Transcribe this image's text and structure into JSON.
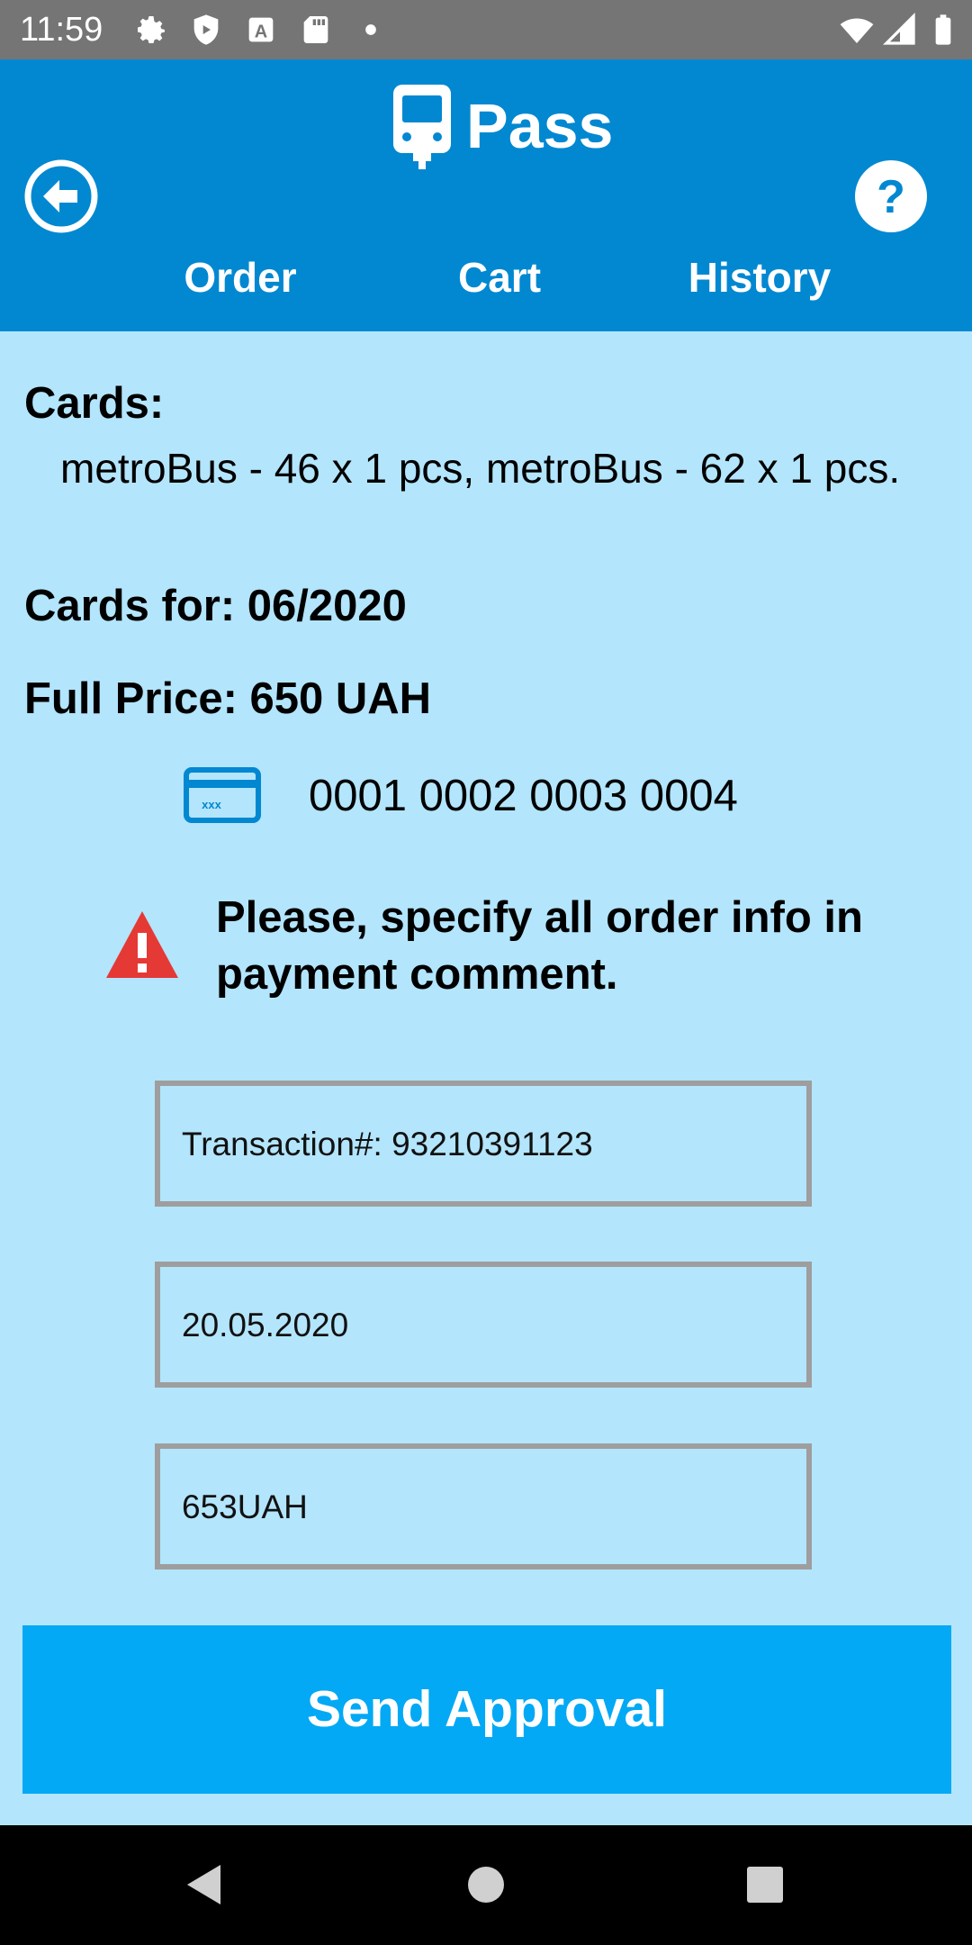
{
  "status_bar": {
    "time": "11:59",
    "left_icons": [
      "gear-icon",
      "shield-icon",
      "font-icon",
      "sd-card-icon",
      "dot-icon"
    ],
    "right_icons": [
      "wifi-icon",
      "signal-icon",
      "battery-icon"
    ]
  },
  "header": {
    "title": "Pass",
    "logo_icon": "bus-icon",
    "back_icon": "arrow-left-circle-icon",
    "help_icon": "help-circle-icon",
    "tabs": [
      {
        "label": "Order"
      },
      {
        "label": "Cart"
      },
      {
        "label": "History"
      }
    ]
  },
  "order": {
    "cards_heading": "Cards:",
    "cards_list": "metroBus - 46 x 1 pcs,  metroBus - 62 x 1 pcs.",
    "cards_for": "Cards for: 06/2020",
    "full_price": "Full Price: 650 UAH",
    "card_icon": "credit-card-icon",
    "card_number": "0001 0002 0003 0004",
    "warning_icon": "warning-triangle-icon",
    "warning_text": "Please, specify all order info in payment comment."
  },
  "fields": {
    "transaction": "Transaction#: 93210391123",
    "date": "20.05.2020",
    "amount": "653UAH"
  },
  "actions": {
    "send_label": "Send Approval"
  },
  "colors": {
    "header": "#0288D1",
    "background": "#B3E5FC",
    "button": "#03A9F4",
    "warning": "#E53935"
  },
  "nav_bar": {
    "icons": [
      "nav-back-icon",
      "nav-home-icon",
      "nav-recents-icon"
    ]
  }
}
